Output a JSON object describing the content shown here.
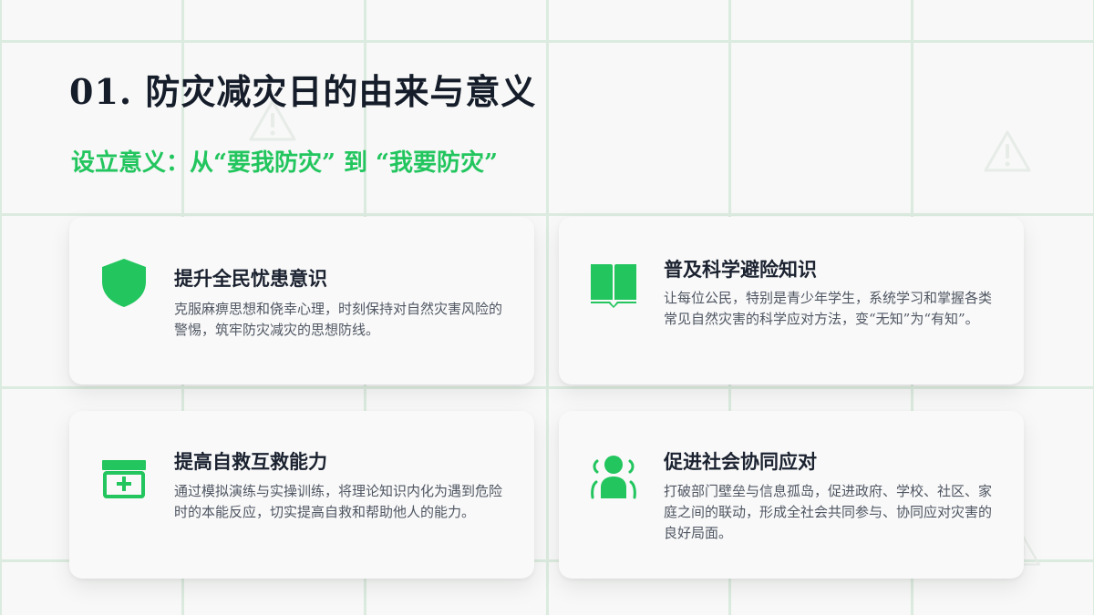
{
  "slide": {
    "title": "01.  防灾减灾日的由来与意义",
    "subtitle": "设立意义：从“要我防灾” 到 “我要防灾”"
  },
  "colors": {
    "accent": "#22c55e",
    "title": "#161d2a",
    "body_text": "#4f5662",
    "grid_line": "#dcebdf",
    "background": "#f7f8f7"
  },
  "background_icons": [
    "warning-icon",
    "warning-icon",
    "warning-icon"
  ],
  "cards": [
    {
      "icon": "shield-icon",
      "title": "提升全民忧患意识",
      "description": "克服麻痹思想和侥幸心理，时刻保持对自然灾害风险的警惕，筑牢防灾减灾的思想防线。"
    },
    {
      "icon": "book-icon",
      "title": "普及科学避险知识",
      "description": "让每位公民，特别是青少年学生，系统学习和掌握各类常见自然灾害的科学应对方法，变“无知”为“有知”。"
    },
    {
      "icon": "first-aid-kit-icon",
      "title": "提高自救互救能力",
      "description": "通过模拟演练与实操训练，将理论知识内化为遇到危险时的本能反应，切实提高自救和帮助他人的能力。"
    },
    {
      "icon": "community-icon",
      "title": "促进社会协同应对",
      "description": "打破部门壁垒与信息孤岛，促进政府、学校、社区、家庭之间的联动，形成全社会共同参与、协同应对灾害的良好局面。"
    }
  ]
}
